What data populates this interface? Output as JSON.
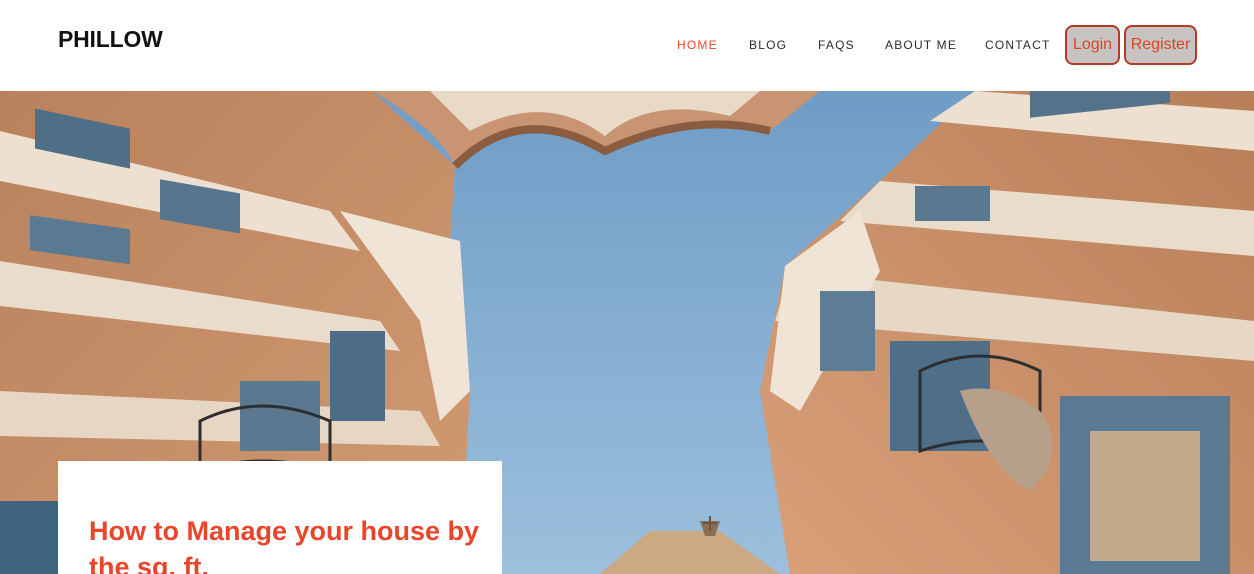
{
  "site": {
    "logo": "PHILLOW"
  },
  "nav": {
    "items": [
      {
        "label": "HOME",
        "active": true
      },
      {
        "label": "BLOG",
        "active": false
      },
      {
        "label": "FAQS",
        "active": false
      },
      {
        "label": "ABOUT ME",
        "active": false
      },
      {
        "label": "CONTACT",
        "active": false
      }
    ]
  },
  "auth": {
    "login_label": "Login",
    "register_label": "Register"
  },
  "hero": {
    "image": "upward-view-of-buildings-and-sky"
  },
  "featured": {
    "title": "How to Manage your house by the sq. ft."
  },
  "colors": {
    "accent": "#e8452a",
    "button_bg": "#c7c3c1",
    "button_border": "#b33a24",
    "sky": "#7fa9cf",
    "facade": "#c48a63"
  }
}
